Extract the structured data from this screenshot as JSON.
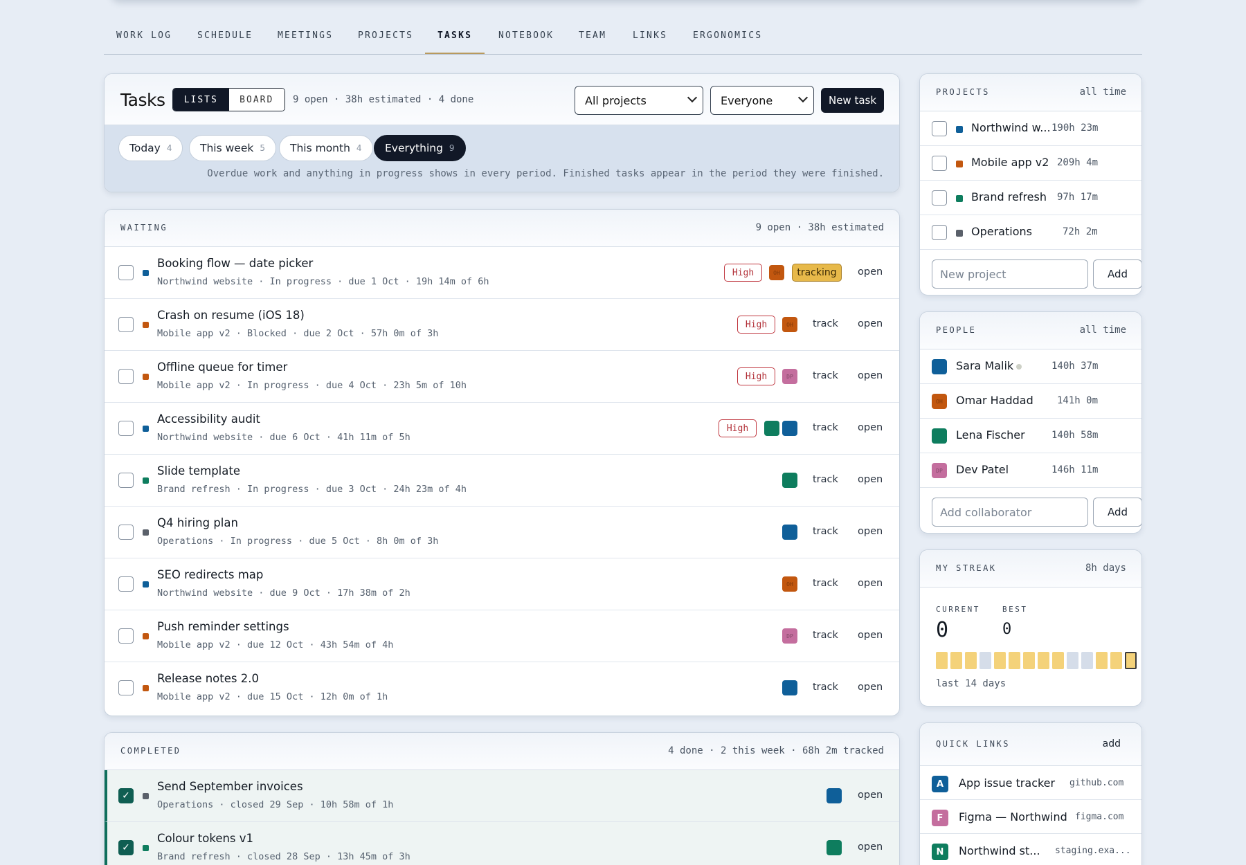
{
  "nav": {
    "tabs": [
      {
        "label": "WORK LOG"
      },
      {
        "label": "SCHEDULE"
      },
      {
        "label": "MEETINGS"
      },
      {
        "label": "PROJECTS"
      },
      {
        "label": "TASKS"
      },
      {
        "label": "NOTEBOOK"
      },
      {
        "label": "TEAM"
      },
      {
        "label": "LINKS"
      },
      {
        "label": "ERGONOMICS"
      }
    ],
    "active": "TASKS"
  },
  "tasks_header": {
    "title": "Tasks",
    "view_lists": "LISTS",
    "view_board": "BOARD",
    "summary": "9 open · 38h estimated · 4 done",
    "project_filter": "All projects",
    "people_filter": "Everyone",
    "new_task_label": "New task"
  },
  "periods": [
    {
      "label": "Today",
      "count": "4"
    },
    {
      "label": "This week",
      "count": "5"
    },
    {
      "label": "This month",
      "count": "4"
    },
    {
      "label": "Everything",
      "count": "9"
    }
  ],
  "period_note": "Overdue work and anything in progress shows in every period. Finished tasks appear in the period they were finished.",
  "waiting": {
    "label": "WAITING",
    "summary": "9 open · 38h estimated",
    "tasks": [
      {
        "title": "Booking flow — date picker",
        "sub": "Northwind website · In progress · due 1 Oct · 19h 14m of 6h",
        "priority": "High",
        "tracking": "tracking",
        "open": "open"
      },
      {
        "title": "Crash on resume (iOS 18)",
        "sub": "Mobile app v2 · Blocked · due 2 Oct · 57h 0m of 3h",
        "priority": "High",
        "track": "track",
        "open": "open"
      },
      {
        "title": "Offline queue for timer",
        "sub": "Mobile app v2 · In progress · due 4 Oct · 23h 5m of 10h",
        "priority": "High",
        "track": "track",
        "open": "open"
      },
      {
        "title": "Accessibility audit",
        "sub": "Northwind website · due 6 Oct · 41h 11m of 5h",
        "priority": "High",
        "track": "track",
        "open": "open"
      },
      {
        "title": "Slide template",
        "sub": "Brand refresh · In progress · due 3 Oct · 24h 23m of 4h",
        "track": "track",
        "open": "open"
      },
      {
        "title": "Q4 hiring plan",
        "sub": "Operations · In progress · due 5 Oct · 8h 0m of 3h",
        "track": "track",
        "open": "open"
      },
      {
        "title": "SEO redirects map",
        "sub": "Northwind website · due 9 Oct · 17h 38m of 2h",
        "track": "track",
        "open": "open"
      },
      {
        "title": "Push reminder settings",
        "sub": "Mobile app v2 · due 12 Oct · 43h 54m of 4h",
        "track": "track",
        "open": "open"
      },
      {
        "title": "Release notes 2.0",
        "sub": "Mobile app v2 · due 15 Oct · 12h 0m of 1h",
        "track": "track",
        "open": "open"
      }
    ]
  },
  "completed": {
    "label": "COMPLETED",
    "summary": "4 done · 2 this week · 68h 2m tracked",
    "tasks": [
      {
        "title": "Send September invoices",
        "sub": "Operations · closed 29 Sep · 10h 58m of 1h",
        "open": "open"
      },
      {
        "title": "Colour tokens v1",
        "sub": "Brand refresh · closed 28 Sep · 13h 45m of 3h",
        "open": "open"
      }
    ]
  },
  "avatars": {
    "OH": "OH",
    "DP": "DP"
  },
  "projects_card": {
    "label": "PROJECTS",
    "scope": "all time",
    "items": [
      {
        "name": "Northwind w...",
        "time": "190h 23m"
      },
      {
        "name": "Mobile app v2",
        "time": "209h 4m"
      },
      {
        "name": "Brand refresh",
        "time": "97h 17m"
      },
      {
        "name": "Operations",
        "time": "72h 2m"
      }
    ],
    "input_placeholder": "New project",
    "add_label": "Add"
  },
  "people_card": {
    "label": "PEOPLE",
    "scope": "all time",
    "items": [
      {
        "name": "Sara Malik",
        "time": "140h 37m"
      },
      {
        "name": "Omar Haddad",
        "time": "141h 0m"
      },
      {
        "name": "Lena Fischer",
        "time": "140h 58m"
      },
      {
        "name": "Dev Patel",
        "time": "146h 11m"
      }
    ],
    "input_placeholder": "Add collaborator",
    "add_label": "Add"
  },
  "streak_card": {
    "label": "MY STREAK",
    "unit": "8h days",
    "current_label": "CURRENT",
    "best_label": "BEST",
    "current": "0",
    "best": "0",
    "footer": "last 14 days"
  },
  "quick_links": {
    "label": "QUICK LINKS",
    "add_label": "add",
    "items": [
      {
        "letter": "A",
        "name": "App issue tracker",
        "host": "github.com"
      },
      {
        "letter": "F",
        "name": "Figma — Northwind",
        "host": "figma.com"
      },
      {
        "letter": "N",
        "name": "Northwind st...",
        "host": "staging.exa..."
      }
    ]
  },
  "colors": {
    "northwind": "#0f5f99",
    "mobile": "#c2570f",
    "brand": "#0e7d5e",
    "operations": "#5a606a",
    "devpatel": "#c46e9e",
    "accent_dark": "#111827",
    "high": "#c0373f"
  }
}
